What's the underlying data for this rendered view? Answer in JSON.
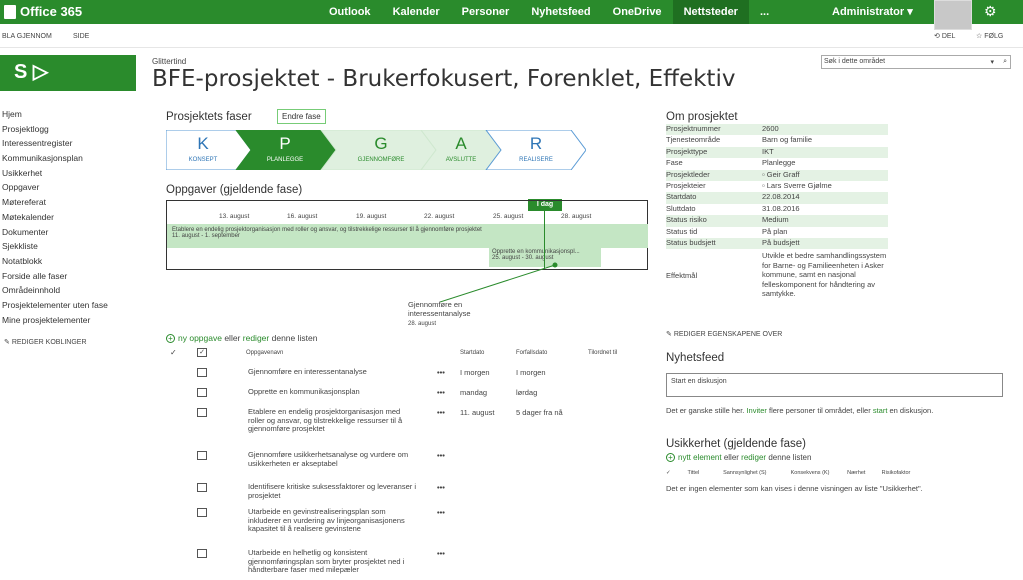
{
  "app": {
    "name": "Office 365"
  },
  "topnav": [
    "Outlook",
    "Kalender",
    "Personer",
    "Nyhetsfeed",
    "OneDrive",
    "Nettsteder",
    "..."
  ],
  "user": "Administrator",
  "ribbon": {
    "browse": "BLA GJENNOM",
    "page": "SIDE",
    "share": "DEL",
    "follow": "FØLG"
  },
  "site": {
    "name": "Glittertind",
    "title": "BFE-prosjektet - Brukerfokusert, Forenklet, Effektiv",
    "search_placeholder": "Søk i dette området"
  },
  "leftnav": [
    "Hjem",
    "Prosjektlogg",
    "Interessentregister",
    "Kommunikasjonsplan",
    "Usikkerhet",
    "Oppgaver",
    "Møtereferat",
    "Møtekalender",
    "Dokumenter",
    "Sjekkliste",
    "Notatblokk",
    "Forside alle faser",
    "Områdeinnhold",
    "Prosjektelementer uten fase",
    "Mine prosjektelementer"
  ],
  "edit_links": "REDIGER KOBLINGER",
  "phases": {
    "title": "Prosjektets faser",
    "change": "Endre fase",
    "items": [
      {
        "letter": "K",
        "name": "KONSEPT"
      },
      {
        "letter": "P",
        "name": "PLANLEGGE"
      },
      {
        "letter": "G",
        "name": "GJENNOMFØRE"
      },
      {
        "letter": "A",
        "name": "AVSLUTTE"
      },
      {
        "letter": "R",
        "name": "REALISERE"
      }
    ],
    "active": "PLANLEGGE"
  },
  "tasks_section": {
    "title": "Oppgaver (gjeldende fase)"
  },
  "timeline": {
    "today": "I dag",
    "ticks": [
      "13. august",
      "16. august",
      "19. august",
      "22. august",
      "25. august",
      "28. august"
    ],
    "bar1_title": "Etablere en endelig prosjektorganisasjon med roller og ansvar, og tilstrekkelige ressurser til å gjennomføre prosjektet",
    "bar1_dates": "11. august - 1. september",
    "bar2_title": "Opprette en kommunikasjonspl...",
    "bar2_dates": "25. august - 30. august",
    "callout_title": "Gjennomføre en interessentanalyse",
    "callout_date": "28. august"
  },
  "new_task": {
    "new": "ny oppgave",
    "or": "eller",
    "edit": "rediger",
    "rest": "denne listen"
  },
  "task_cols": [
    "Oppgavenavn",
    "Startdato",
    "Forfallsdato",
    "Tilordnet til"
  ],
  "tasks": [
    {
      "name": "Gjennomføre en interessentanalyse",
      "start": "I morgen",
      "due": "I morgen"
    },
    {
      "name": "Opprette en kommunikasjonsplan",
      "start": "mandag",
      "due": "lørdag"
    },
    {
      "name": "Etablere en endelig prosjektorganisasjon med roller og ansvar, og tilstrekkelige ressurser til å gjennomføre prosjektet",
      "start": "11. august",
      "due": "5 dager fra nå"
    },
    {
      "name": "Gjennomføre usikkerhetsanalyse og vurdere om usikkerheten er akseptabel",
      "start": "",
      "due": ""
    },
    {
      "name": "Identifisere kritiske suksessfaktorer og leveranser i prosjektet",
      "start": "",
      "due": ""
    },
    {
      "name": "Utarbeide en gevinstrealiseringsplan som inkluderer en vurdering av linjeorganisasjonens kapasitet til å realisere gevinstene",
      "start": "",
      "due": ""
    },
    {
      "name": "Utarbeide en helhetlig og konsistent gjennomføringsplan som bryter prosjektet ned i håndterbare faser med milepæler",
      "start": "",
      "due": ""
    }
  ],
  "about": {
    "title": "Om prosjektet",
    "props": [
      {
        "k": "Prosjektnummer",
        "v": "2600"
      },
      {
        "k": "Tjenesteområde",
        "v": "Barn og familie"
      },
      {
        "k": "Prosjekttype",
        "v": "IKT"
      },
      {
        "k": "Fase",
        "v": "Planlegge"
      },
      {
        "k": "Prosjektleder",
        "v": "Geir Graff"
      },
      {
        "k": "Prosjekteier",
        "v": "Lars Sverre Gjølme"
      },
      {
        "k": "Startdato",
        "v": "22.08.2014"
      },
      {
        "k": "Sluttdato",
        "v": "31.08.2016"
      },
      {
        "k": "Status risiko",
        "v": "Medium"
      },
      {
        "k": "Status tid",
        "v": "På plan"
      },
      {
        "k": "Status budsjett",
        "v": "På budsjett"
      },
      {
        "k": "Effektmål",
        "v": "Utvikle et bedre samhandlingssystem for Barne- og Familieenheten i Asker kommune, samt en nasjonal felleskomponent for håndtering av samtykke."
      }
    ],
    "edit": "REDIGER EGENSKAPENE OVER"
  },
  "newsfeed": {
    "title": "Nyhetsfeed",
    "placeholder": "Start en diskusjon",
    "quiet1": "Det er ganske stille her.",
    "invite": "Inviter",
    "quiet2": "flere personer til området, eller",
    "start": "start",
    "quiet3": "en diskusjon."
  },
  "risk": {
    "title": "Usikkerhet (gjeldende fase)",
    "new": "nytt element",
    "or": "eller",
    "edit": "rediger",
    "rest": "denne listen",
    "cols": [
      "Tittel",
      "Sannsynlighet (S)",
      "Konsekvens (K)",
      "Nærhet",
      "Risikofaktor"
    ],
    "empty": "Det er ingen elementer som kan vises i denne visningen av liste \"Usikkerhet\"."
  },
  "colors": {
    "accent": "#2a8b2c",
    "light": "#c4e6c4"
  }
}
